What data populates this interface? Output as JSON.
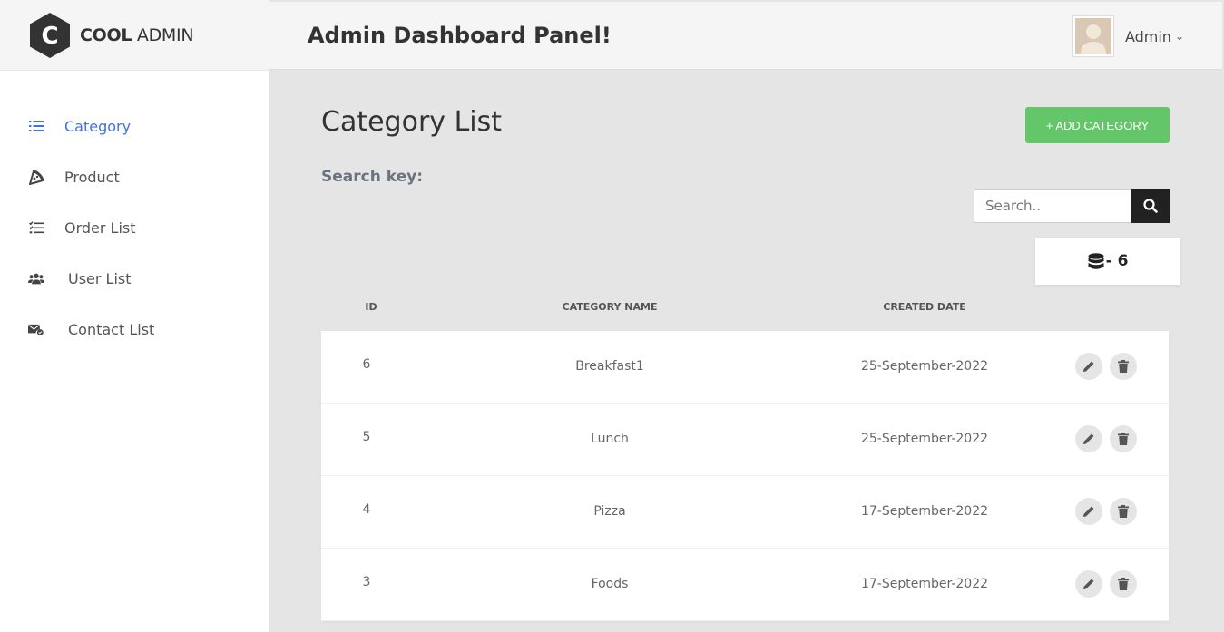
{
  "brand": {
    "bold": "COOL",
    "light": "ADMIN",
    "mark": "C"
  },
  "header": {
    "title": "Admin Dashboard Panel!",
    "user": "Admin"
  },
  "sidebar": {
    "items": [
      {
        "label": "Category",
        "icon": "list-icon",
        "active": true
      },
      {
        "label": "Product",
        "icon": "pizza-icon"
      },
      {
        "label": "Order List",
        "icon": "checklist-icon"
      },
      {
        "label": "User List",
        "icon": "users-icon"
      },
      {
        "label": "Contact List",
        "icon": "envelope-check-icon"
      }
    ]
  },
  "main": {
    "title": "Category List",
    "add_button": "+ ADD CATEGORY",
    "search_label": "Search key:",
    "search_placeholder": "Search..",
    "count": "- 6",
    "columns": [
      "ID",
      "CATEGORY NAME",
      "CREATED DATE"
    ],
    "rows": [
      {
        "id": "6",
        "name": "Breakfast1",
        "date": "25-September-2022"
      },
      {
        "id": "5",
        "name": "Lunch",
        "date": "25-September-2022"
      },
      {
        "id": "4",
        "name": "Pizza",
        "date": "17-September-2022"
      },
      {
        "id": "3",
        "name": "Foods",
        "date": "17-September-2022"
      }
    ]
  },
  "colors": {
    "accent": "#4272d7",
    "add_button": "#63c76a",
    "search_button": "#212121"
  }
}
